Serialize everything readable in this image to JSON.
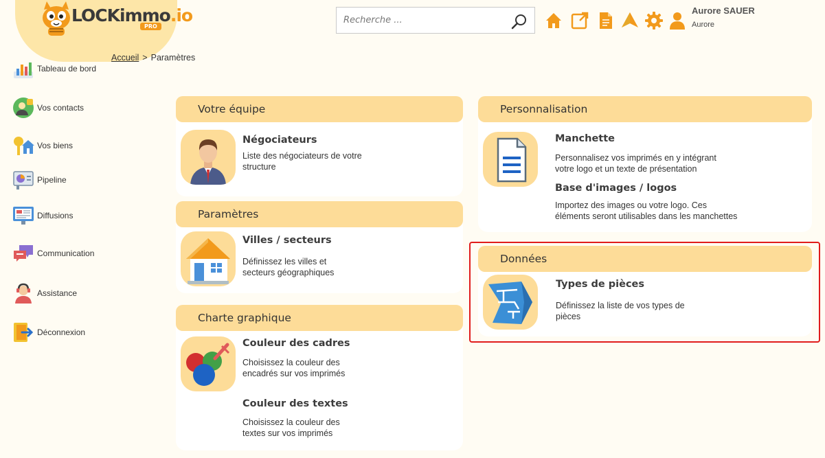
{
  "logo": {
    "main": "LOCKimmo",
    "accent": ".io",
    "badge": "PRO"
  },
  "search": {
    "placeholder": "Recherche ..."
  },
  "user": {
    "name": "Aurore SAUER",
    "subtitle": "Aurore"
  },
  "sidebar": {
    "items": [
      {
        "label": "Tableau de bord",
        "icon": "dashboard-icon"
      },
      {
        "label": "Vos contacts",
        "icon": "contacts-icon"
      },
      {
        "label": "Vos biens",
        "icon": "properties-icon"
      },
      {
        "label": "Pipeline",
        "icon": "pipeline-icon"
      },
      {
        "label": "Diffusions",
        "icon": "diffusion-icon"
      },
      {
        "label": "Communication",
        "icon": "communication-icon"
      },
      {
        "label": "Assistance",
        "icon": "assistance-icon"
      },
      {
        "label": "Déconnexion",
        "icon": "logout-icon"
      }
    ]
  },
  "breadcrumb": {
    "home": "Accueil",
    "separator": ">",
    "current": "Paramètres"
  },
  "sections": {
    "equipe": {
      "title": "Votre équipe",
      "items": [
        {
          "title": "Négociateurs",
          "desc1": "Liste des négociateurs de votre",
          "desc2": "structure"
        }
      ]
    },
    "parametres": {
      "title": "Paramètres",
      "items": [
        {
          "title": "Villes / secteurs",
          "desc1": "Définissez les villes et",
          "desc2": "secteurs géographiques"
        }
      ]
    },
    "charte": {
      "title": "Charte graphique",
      "items": [
        {
          "title": "Couleur des cadres",
          "desc1": "Choisissez la couleur des",
          "desc2": "encadrés sur vos imprimés"
        },
        {
          "title": "Couleur des textes",
          "desc1": "Choisissez la couleur des",
          "desc2": "textes sur vos imprimés"
        }
      ]
    },
    "personnalisation": {
      "title": "Personnalisation",
      "items": [
        {
          "title": "Manchette",
          "desc1": "Personnalisez vos imprimés en y intégrant",
          "desc2": "votre logo et un texte de présentation"
        },
        {
          "title": "Base d'images / logos",
          "desc1": "Importez des images ou votre logo. Ces",
          "desc2": "éléments seront utilisables dans les manchettes"
        }
      ]
    },
    "donnees": {
      "title": "Données",
      "items": [
        {
          "title": "Types de pièces",
          "desc1": "Définissez la liste de vos types de",
          "desc2": "pièces"
        }
      ]
    }
  },
  "colors": {
    "accent": "#f29a1c",
    "card_header": "#fddc98",
    "highlight": "#e01b1b",
    "background": "#fffcf3"
  }
}
